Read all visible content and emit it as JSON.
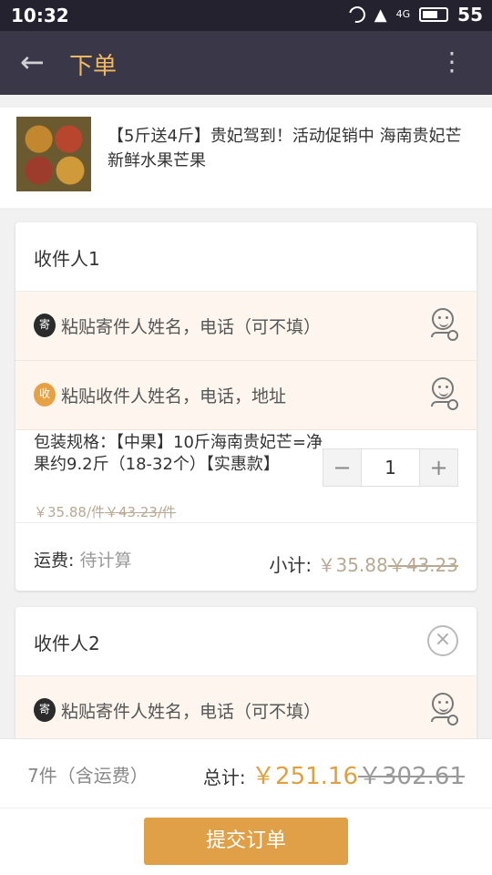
{
  "status_bar": {
    "time": "10:32",
    "network": "4G",
    "battery": "55",
    "icons": [
      "moon-icon",
      "wifi-icon",
      "signal-icon",
      "battery-icon"
    ]
  },
  "header": {
    "back_icon": "arrow-left-icon",
    "title": "下单",
    "more_icon": "more-vertical-icon",
    "accent_color": "#f0b960"
  },
  "product": {
    "title": "【5斤送4斤】贵妃驾到！活动促销中 海南贵妃芒 新鲜水果芒果",
    "thumbnail": "mango-photo"
  },
  "recipients": [
    {
      "name": "收件人1",
      "sender_badge": "寄",
      "sender_placeholder": "粘贴寄件人姓名，电话（可不填）",
      "receiver_badge": "收",
      "receiver_placeholder": "粘贴收件人姓名，电话，地址",
      "spec": "包装规格：【中果】10斤海南贵妃芒=净果约9.2斤（18-32个）【实惠款】",
      "price_current": "￥35.88/件",
      "price_original": "￥43.23/件",
      "quantity": "1",
      "minus": "−",
      "plus": "+",
      "shipping_label": "运费:",
      "shipping_value": "待计算",
      "subtotal_label": "小计:",
      "subtotal_current": "￥35.88",
      "subtotal_original": "￥43.23"
    },
    {
      "name": "收件人2",
      "close_icon": "close-circle-icon",
      "sender_badge": "寄",
      "sender_placeholder": "粘贴寄件人姓名，电话（可不填）"
    }
  ],
  "footer": {
    "count": "7件（含运费）",
    "total_label": "总计:",
    "total_current": "￥251.16",
    "total_original": "￥302.61",
    "submit": "提交订单",
    "accent_color": "#e0a047"
  }
}
